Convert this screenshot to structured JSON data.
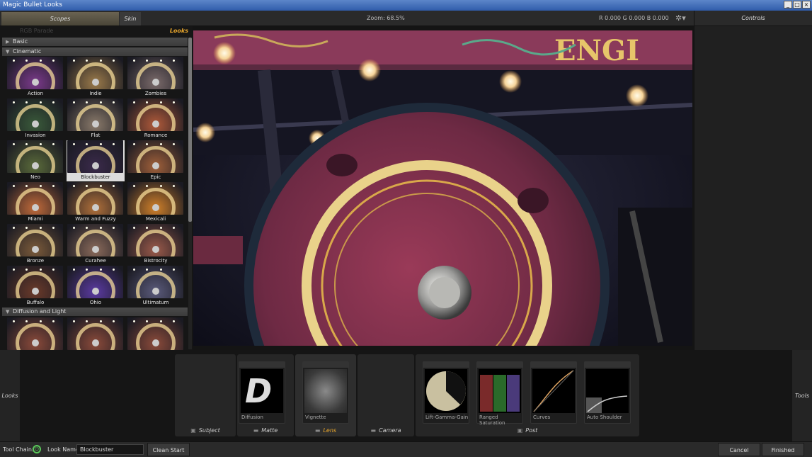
{
  "window": {
    "title": "Magic Bullet Looks",
    "min": "_",
    "max": "□",
    "close": "×"
  },
  "topbar": {
    "tabs": [
      {
        "label": "Scopes"
      },
      {
        "label": "Skin"
      }
    ],
    "zoom": "Zoom:  68.5%",
    "rgb": "R 0.000   G 0.000   B 0.000",
    "controls": "Controls"
  },
  "left_panel": {
    "ghost": "RGB Parade",
    "looks_label": "Looks",
    "categories": [
      {
        "label": "Basic",
        "expanded": false
      },
      {
        "label": "Cinematic",
        "expanded": true
      },
      {
        "label": "Diffusion and Light",
        "expanded": true
      }
    ],
    "cinematic_looks": [
      {
        "name": "Action",
        "tint": "#7a3a8a"
      },
      {
        "name": "Indie",
        "tint": "#9a7a4a"
      },
      {
        "name": "Zombies",
        "tint": "#7a6a6a"
      },
      {
        "name": "Invasion",
        "tint": "#3a5a3a"
      },
      {
        "name": "Flat",
        "tint": "#8a7a6a"
      },
      {
        "name": "Romance",
        "tint": "#b05a3a"
      },
      {
        "name": "Neo",
        "tint": "#5a6a3a"
      },
      {
        "name": "Blockbuster",
        "tint": "#3a2a4a"
      },
      {
        "name": "Epic",
        "tint": "#a0603a"
      },
      {
        "name": "Miami",
        "tint": "#c06a3a"
      },
      {
        "name": "Warm and Fuzzy",
        "tint": "#b0703a"
      },
      {
        "name": "Mexicali",
        "tint": "#d0802a"
      },
      {
        "name": "Bronze",
        "tint": "#7a5a3a"
      },
      {
        "name": "Curahee",
        "tint": "#8a6a5a"
      },
      {
        "name": "Bistrocity",
        "tint": "#9a5a4a"
      },
      {
        "name": "Buffalo",
        "tint": "#6a3a2a"
      },
      {
        "name": "Ohio",
        "tint": "#5a3aa0"
      },
      {
        "name": "Ultimatum",
        "tint": "#5a5a7a"
      }
    ],
    "diffusion_looks": [
      {
        "name": "",
        "tint": "#8a4a3a"
      },
      {
        "name": "",
        "tint": "#8a4a3a"
      },
      {
        "name": "",
        "tint": "#8a4a3a"
      }
    ],
    "selected": "Blockbuster"
  },
  "toolchain": {
    "left_label": "Looks",
    "right_label": "Tools",
    "groups": [
      {
        "label": "Subject",
        "active": false
      },
      {
        "label": "Matte",
        "active": false
      },
      {
        "label": "Lens",
        "active": true
      },
      {
        "label": "Camera",
        "active": false
      },
      {
        "label": "Post",
        "active": false
      }
    ],
    "tools": [
      {
        "label": "Diffusion",
        "icon": "diffusion-icon"
      },
      {
        "label": "Vignette",
        "icon": "vignette-icon"
      },
      {
        "label": "Lift-Gamma-Gain",
        "icon": "lift-gamma-gain-icon"
      },
      {
        "label": "Ranged Saturation",
        "icon": "ranged-saturation-icon"
      },
      {
        "label": "Curves",
        "icon": "curves-icon"
      },
      {
        "label": "Auto Shoulder",
        "icon": "auto-shoulder-icon"
      }
    ],
    "diffusion_glyph": "D"
  },
  "statusbar": {
    "tool_chain_label": "Tool Chain:",
    "look_name_label": "Look Name:",
    "look_name_value": "Blockbuster",
    "clean_start": "Clean Start",
    "cancel": "Cancel",
    "finished": "Finished"
  },
  "colors": {
    "accent": "#e8a62c",
    "power": "#5ac85a"
  }
}
